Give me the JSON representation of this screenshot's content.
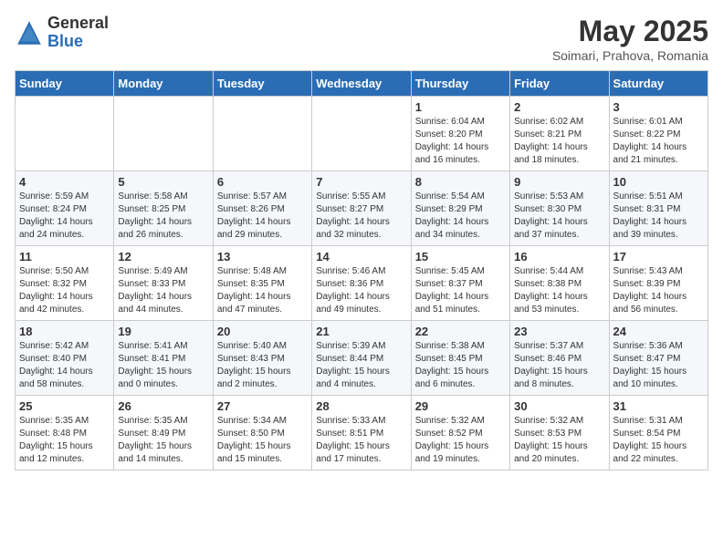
{
  "header": {
    "logo_general": "General",
    "logo_blue": "Blue",
    "month_title": "May 2025",
    "subtitle": "Soimari, Prahova, Romania"
  },
  "calendar": {
    "days_of_week": [
      "Sunday",
      "Monday",
      "Tuesday",
      "Wednesday",
      "Thursday",
      "Friday",
      "Saturday"
    ],
    "weeks": [
      [
        {
          "day": "",
          "info": ""
        },
        {
          "day": "",
          "info": ""
        },
        {
          "day": "",
          "info": ""
        },
        {
          "day": "",
          "info": ""
        },
        {
          "day": "1",
          "info": "Sunrise: 6:04 AM\nSunset: 8:20 PM\nDaylight: 14 hours\nand 16 minutes."
        },
        {
          "day": "2",
          "info": "Sunrise: 6:02 AM\nSunset: 8:21 PM\nDaylight: 14 hours\nand 18 minutes."
        },
        {
          "day": "3",
          "info": "Sunrise: 6:01 AM\nSunset: 8:22 PM\nDaylight: 14 hours\nand 21 minutes."
        }
      ],
      [
        {
          "day": "4",
          "info": "Sunrise: 5:59 AM\nSunset: 8:24 PM\nDaylight: 14 hours\nand 24 minutes."
        },
        {
          "day": "5",
          "info": "Sunrise: 5:58 AM\nSunset: 8:25 PM\nDaylight: 14 hours\nand 26 minutes."
        },
        {
          "day": "6",
          "info": "Sunrise: 5:57 AM\nSunset: 8:26 PM\nDaylight: 14 hours\nand 29 minutes."
        },
        {
          "day": "7",
          "info": "Sunrise: 5:55 AM\nSunset: 8:27 PM\nDaylight: 14 hours\nand 32 minutes."
        },
        {
          "day": "8",
          "info": "Sunrise: 5:54 AM\nSunset: 8:29 PM\nDaylight: 14 hours\nand 34 minutes."
        },
        {
          "day": "9",
          "info": "Sunrise: 5:53 AM\nSunset: 8:30 PM\nDaylight: 14 hours\nand 37 minutes."
        },
        {
          "day": "10",
          "info": "Sunrise: 5:51 AM\nSunset: 8:31 PM\nDaylight: 14 hours\nand 39 minutes."
        }
      ],
      [
        {
          "day": "11",
          "info": "Sunrise: 5:50 AM\nSunset: 8:32 PM\nDaylight: 14 hours\nand 42 minutes."
        },
        {
          "day": "12",
          "info": "Sunrise: 5:49 AM\nSunset: 8:33 PM\nDaylight: 14 hours\nand 44 minutes."
        },
        {
          "day": "13",
          "info": "Sunrise: 5:48 AM\nSunset: 8:35 PM\nDaylight: 14 hours\nand 47 minutes."
        },
        {
          "day": "14",
          "info": "Sunrise: 5:46 AM\nSunset: 8:36 PM\nDaylight: 14 hours\nand 49 minutes."
        },
        {
          "day": "15",
          "info": "Sunrise: 5:45 AM\nSunset: 8:37 PM\nDaylight: 14 hours\nand 51 minutes."
        },
        {
          "day": "16",
          "info": "Sunrise: 5:44 AM\nSunset: 8:38 PM\nDaylight: 14 hours\nand 53 minutes."
        },
        {
          "day": "17",
          "info": "Sunrise: 5:43 AM\nSunset: 8:39 PM\nDaylight: 14 hours\nand 56 minutes."
        }
      ],
      [
        {
          "day": "18",
          "info": "Sunrise: 5:42 AM\nSunset: 8:40 PM\nDaylight: 14 hours\nand 58 minutes."
        },
        {
          "day": "19",
          "info": "Sunrise: 5:41 AM\nSunset: 8:41 PM\nDaylight: 15 hours\nand 0 minutes."
        },
        {
          "day": "20",
          "info": "Sunrise: 5:40 AM\nSunset: 8:43 PM\nDaylight: 15 hours\nand 2 minutes."
        },
        {
          "day": "21",
          "info": "Sunrise: 5:39 AM\nSunset: 8:44 PM\nDaylight: 15 hours\nand 4 minutes."
        },
        {
          "day": "22",
          "info": "Sunrise: 5:38 AM\nSunset: 8:45 PM\nDaylight: 15 hours\nand 6 minutes."
        },
        {
          "day": "23",
          "info": "Sunrise: 5:37 AM\nSunset: 8:46 PM\nDaylight: 15 hours\nand 8 minutes."
        },
        {
          "day": "24",
          "info": "Sunrise: 5:36 AM\nSunset: 8:47 PM\nDaylight: 15 hours\nand 10 minutes."
        }
      ],
      [
        {
          "day": "25",
          "info": "Sunrise: 5:35 AM\nSunset: 8:48 PM\nDaylight: 15 hours\nand 12 minutes."
        },
        {
          "day": "26",
          "info": "Sunrise: 5:35 AM\nSunset: 8:49 PM\nDaylight: 15 hours\nand 14 minutes."
        },
        {
          "day": "27",
          "info": "Sunrise: 5:34 AM\nSunset: 8:50 PM\nDaylight: 15 hours\nand 15 minutes."
        },
        {
          "day": "28",
          "info": "Sunrise: 5:33 AM\nSunset: 8:51 PM\nDaylight: 15 hours\nand 17 minutes."
        },
        {
          "day": "29",
          "info": "Sunrise: 5:32 AM\nSunset: 8:52 PM\nDaylight: 15 hours\nand 19 minutes."
        },
        {
          "day": "30",
          "info": "Sunrise: 5:32 AM\nSunset: 8:53 PM\nDaylight: 15 hours\nand 20 minutes."
        },
        {
          "day": "31",
          "info": "Sunrise: 5:31 AM\nSunset: 8:54 PM\nDaylight: 15 hours\nand 22 minutes."
        }
      ]
    ]
  }
}
